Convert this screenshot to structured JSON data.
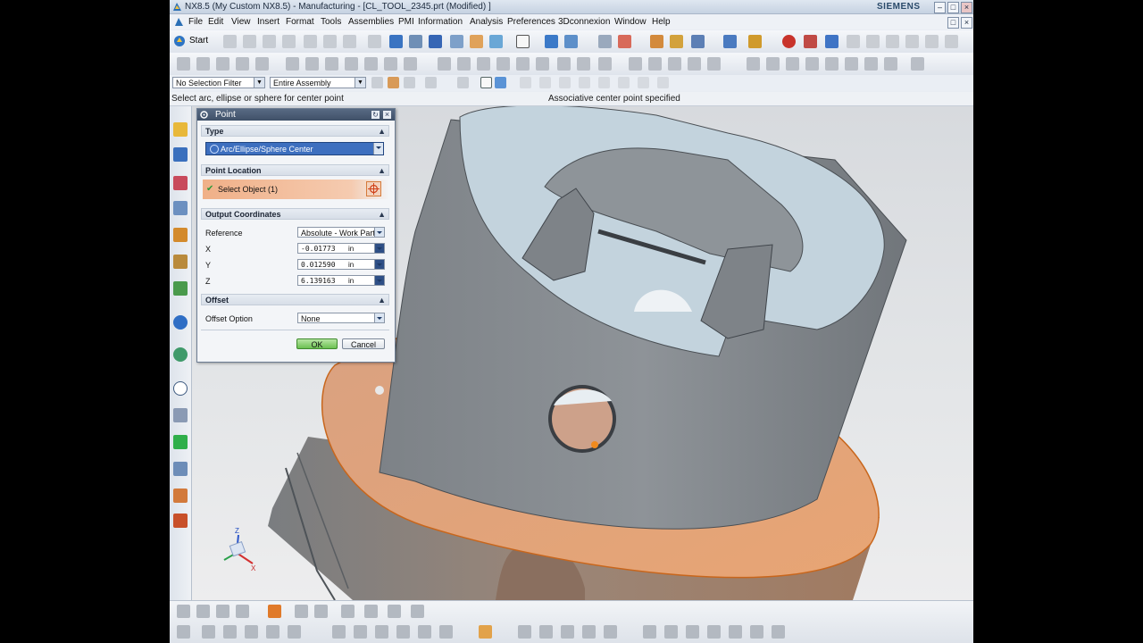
{
  "window": {
    "title": "NX8.5 (My Custom NX8.5) - Manufacturing - [CL_TOOL_2345.prt (Modified) ]",
    "brand": "SIEMENS"
  },
  "menubar": {
    "items": [
      "File",
      "Edit",
      "View",
      "Insert",
      "Format",
      "Tools",
      "Assemblies",
      "PMI",
      "Information",
      "Analysis",
      "Preferences",
      "3Dconnexion",
      "Window",
      "Help"
    ]
  },
  "toolbar": {
    "start_label": "Start"
  },
  "selection_bar": {
    "filter_value": "No Selection Filter",
    "scope_value": "Entire Assembly"
  },
  "cue_line": {
    "prompt": "Select arc, ellipse or sphere for center point",
    "status": "Associative center point specified"
  },
  "dialog": {
    "title": "Point",
    "sections": {
      "type": "Type",
      "point_location": "Point Location",
      "output_coordinates": "Output Coordinates",
      "offset": "Offset"
    },
    "type_value": "Arc/Ellipse/Sphere Center",
    "select_object_label": "Select Object (1)",
    "reference_label": "Reference",
    "reference_value": "Absolute - Work Part",
    "x_label": "X",
    "y_label": "Y",
    "z_label": "Z",
    "x_value": "-0.01773",
    "y_value": "0.012590",
    "z_value": "6.139163",
    "unit": "in",
    "offset_option_label": "Offset Option",
    "offset_option_value": "None",
    "ok_label": "OK",
    "cancel_label": "Cancel"
  },
  "triad": {
    "z": "Z",
    "x": "X"
  },
  "colors": {
    "model_gray": "#8c9196",
    "model_face_light": "#c9d9e3",
    "highlight_orange": "#e59a68",
    "dialog_title": "#4b5c75",
    "selection_blue": "#3d6fbf"
  }
}
